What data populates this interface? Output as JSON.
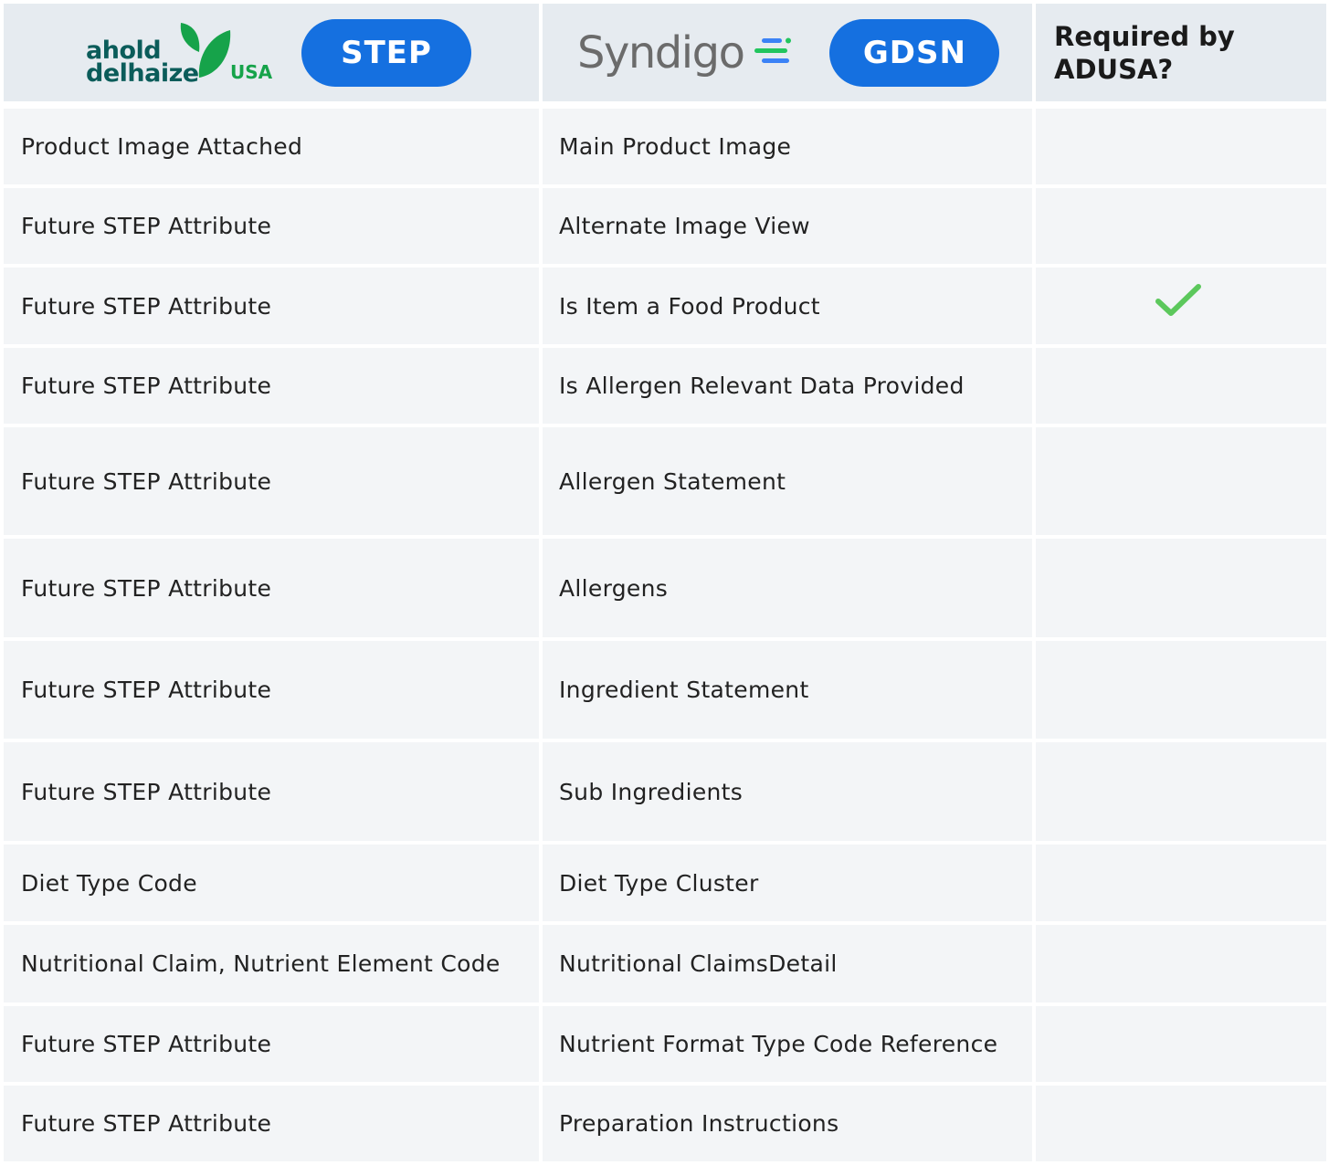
{
  "header": {
    "ahold_logo_text_line1": "ahold",
    "ahold_logo_text_line2": "delhaize",
    "ahold_logo_usa": "USA",
    "step_label": "STEP",
    "syndigo_logo_text": "Syndigo",
    "gdsn_label": "GDSN",
    "required_label": "Required by\nADUSA?"
  },
  "colors": {
    "pill_blue": "#1570e0",
    "header_bg": "#e6ebf0",
    "row_bg": "#f3f5f7",
    "check_green": "#5cc85c",
    "ahold_teal": "#0b5c5a",
    "ahold_green": "#16a34a"
  },
  "rows": [
    {
      "step": "Product Image Attached",
      "gdsn": "Main Product Image",
      "required": false
    },
    {
      "step": "Future STEP Attribute",
      "gdsn": "Alternate Image View",
      "required": false
    },
    {
      "step": "Future STEP Attribute",
      "gdsn": "Is Item a Food Product",
      "required": true
    },
    {
      "step": "Future STEP Attribute",
      "gdsn": "Is Allergen Relevant Data Provided",
      "required": false
    },
    {
      "step": "Future STEP Attribute",
      "gdsn": "Allergen Statement",
      "required": false
    },
    {
      "step": "Future STEP Attribute",
      "gdsn": "Allergens",
      "required": false
    },
    {
      "step": "Future STEP Attribute",
      "gdsn": "Ingredient Statement",
      "required": false
    },
    {
      "step": "Future STEP Attribute",
      "gdsn": "Sub Ingredients",
      "required": false
    },
    {
      "step": "Diet Type Code",
      "gdsn": "Diet Type Cluster",
      "required": false
    },
    {
      "step": "Nutritional Claim, Nutrient Element Code",
      "gdsn": "Nutritional ClaimsDetail",
      "required": false
    },
    {
      "step": "Future STEP Attribute",
      "gdsn": "Nutrient Format Type Code Reference",
      "required": false
    },
    {
      "step": "Future STEP Attribute",
      "gdsn": "Preparation Instructions",
      "required": false
    }
  ]
}
